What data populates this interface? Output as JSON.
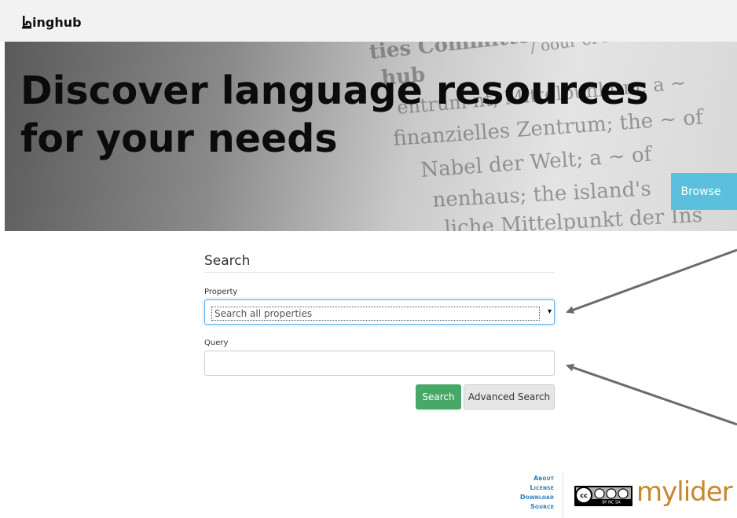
{
  "header": {
    "brand": "inghub"
  },
  "hero": {
    "title_line1": "Discover language resources",
    "title_line2": "for your needs",
    "browse_label": "Browse"
  },
  "search": {
    "title": "Search",
    "property_label": "Property",
    "property_selected": "Search all properties",
    "query_label": "Query",
    "query_value": "",
    "search_button": "Search",
    "advanced_button": "Advanced Search"
  },
  "footer": {
    "links": [
      "About",
      "License",
      "Download",
      "Source"
    ],
    "cc_text": "BY NC SA",
    "partner_logo": "mylider"
  },
  "colors": {
    "browse": "#5bc0de",
    "search_button": "#47a868",
    "link": "#2a7ab8",
    "partner": "#c8872a"
  }
}
